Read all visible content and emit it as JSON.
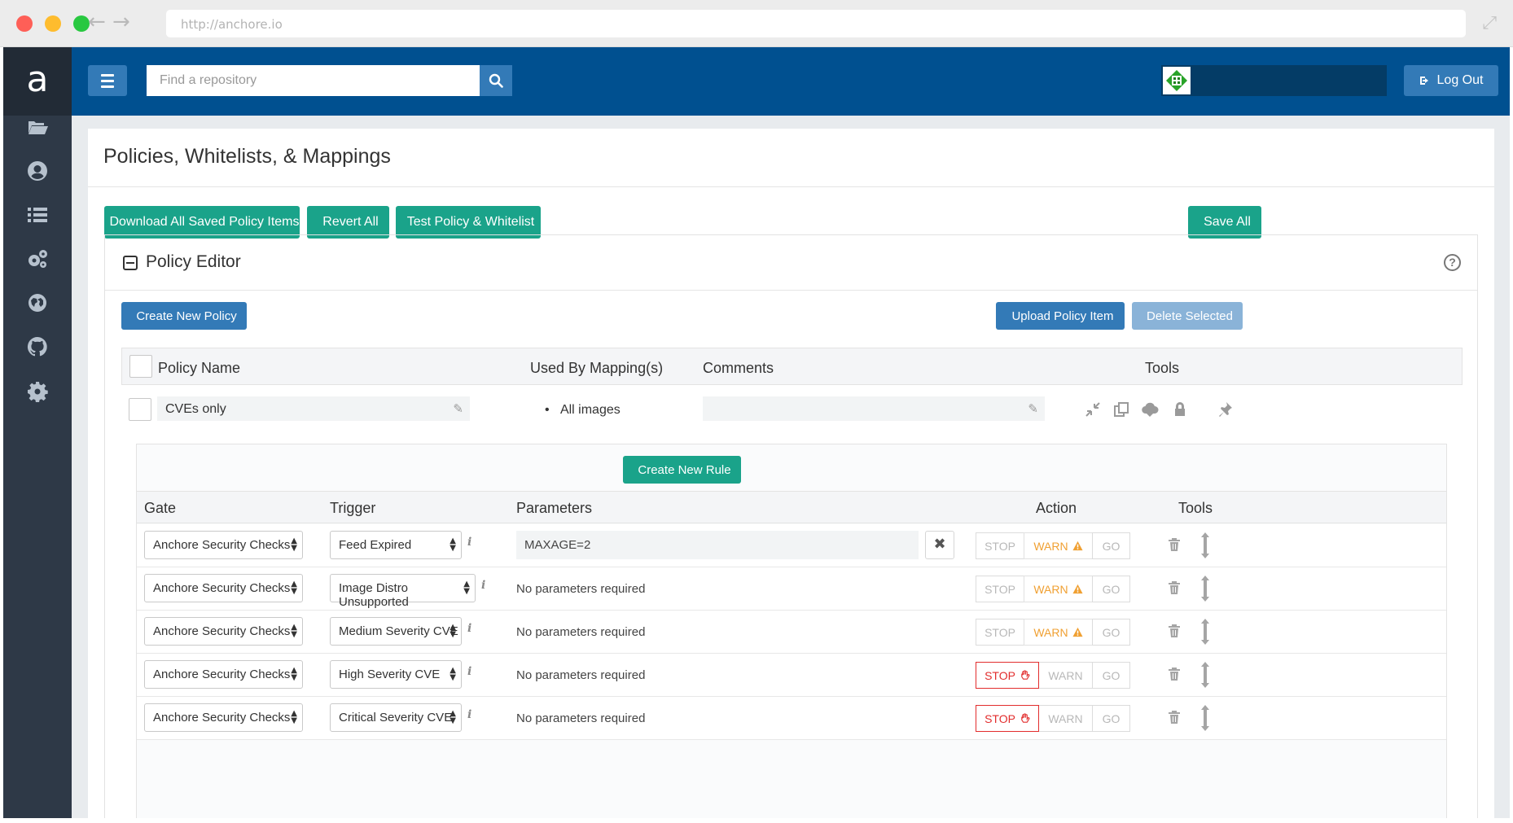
{
  "browser": {
    "url": "http://anchore.io"
  },
  "brand": {
    "letter": "a"
  },
  "topbar": {
    "search_placeholder": "Find a repository",
    "logout_label": "Log Out"
  },
  "page": {
    "title": "Policies, Whitelists, & Mappings",
    "buttons": {
      "download": "Download All Saved Policy Items",
      "revert": "Revert All",
      "test": "Test Policy & Whitelist",
      "save": "Save All"
    }
  },
  "editor": {
    "title": "Policy Editor",
    "create_policy": "Create New Policy",
    "upload": "Upload Policy Item",
    "delete_selected": "Delete Selected",
    "columns": {
      "name": "Policy Name",
      "used_by": "Used By Mapping(s)",
      "comments": "Comments",
      "tools": "Tools"
    },
    "policy": {
      "name": "CVEs only",
      "mapping": "All images",
      "comment": ""
    }
  },
  "rules": {
    "create_rule": "Create New Rule",
    "columns": {
      "gate": "Gate",
      "trigger": "Trigger",
      "parameters": "Parameters",
      "action": "Action",
      "tools": "Tools"
    },
    "action_labels": {
      "stop": "STOP",
      "warn": "WARN",
      "go": "GO"
    },
    "rows": [
      {
        "gate": "Anchore Security Checks",
        "trigger": "Feed Expired",
        "param": "MAXAGE=2",
        "action": "warn"
      },
      {
        "gate": "Anchore Security Checks",
        "trigger": "Image Distro Unsupported",
        "param": "No parameters required",
        "action": "warn"
      },
      {
        "gate": "Anchore Security Checks",
        "trigger": "Medium Severity CVE",
        "param": "No parameters required",
        "action": "warn"
      },
      {
        "gate": "Anchore Security Checks",
        "trigger": "High Severity CVE",
        "param": "No parameters required",
        "action": "stop"
      },
      {
        "gate": "Anchore Security Checks",
        "trigger": "Critical Severity CVE",
        "param": "No parameters required",
        "action": "stop"
      }
    ]
  },
  "colors": {
    "sidebar": "#2e3947",
    "topbar": "#005090",
    "primary": "#337ab7",
    "success": "#1aa38a",
    "warn": "#f0a032",
    "stop": "#e22d2d"
  }
}
